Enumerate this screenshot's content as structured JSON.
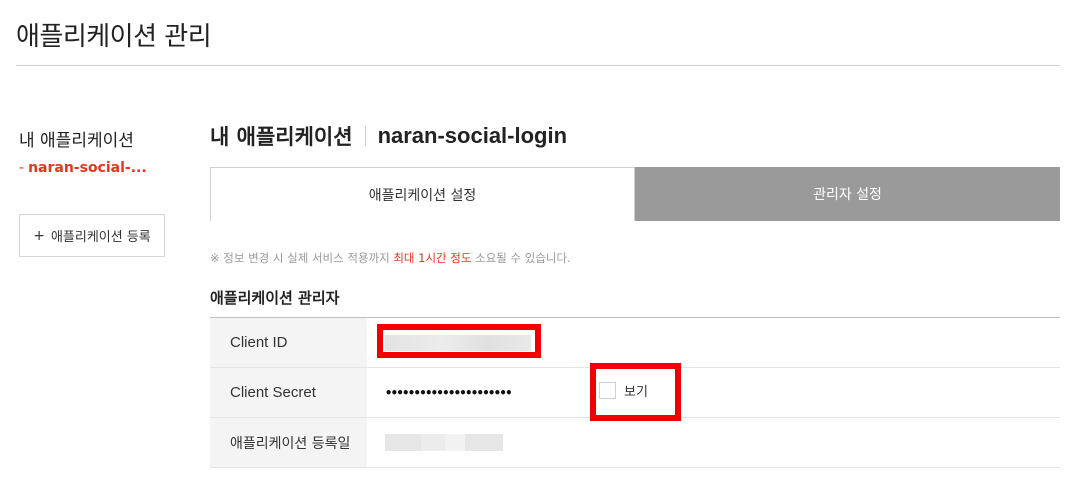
{
  "page": {
    "title": "애플리케이션 관리"
  },
  "sidebar": {
    "heading": "내 애플리케이션",
    "app_link": {
      "prefix": "-",
      "label": "naran-social-..."
    },
    "register_button": {
      "icon": "plus-icon",
      "label": "애플리케이션 등록"
    }
  },
  "main": {
    "title": "내 애플리케이션",
    "app_name": "naran-social-login",
    "tabs": [
      {
        "label": "애플리케이션 설정",
        "active": true
      },
      {
        "label": "관리자 설정",
        "active": false
      }
    ],
    "notice": {
      "prefix": "※ 정보 변경 시 실제 서비스 적용까지 ",
      "highlight": "최대 1시간 정도",
      "suffix": " 소요될 수 있습니다."
    },
    "section_title": "애플리케이션 관리자",
    "table": {
      "client_id_label": "Client ID",
      "client_id_value": "",
      "client_secret_label": "Client Secret",
      "client_secret_value": "••••••••••••••••••••••",
      "show_label": "보기",
      "registered_label": "애플리케이션 등록일",
      "registered_value": ""
    }
  },
  "colors": {
    "accent_red": "#e8341c",
    "highlight_frame": "#f20000",
    "inactive_tab": "#9a9a9a",
    "label_bg": "#f4f4f4"
  }
}
